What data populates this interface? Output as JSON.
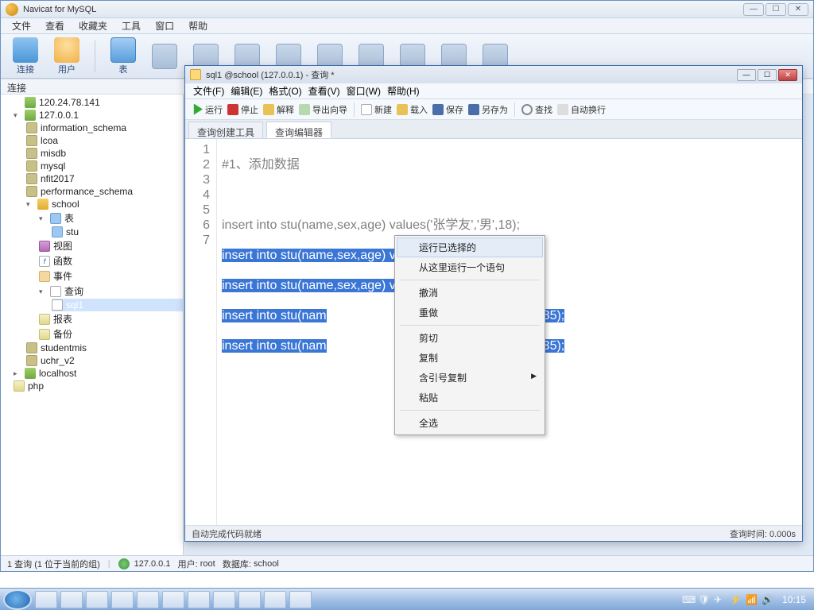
{
  "app": {
    "title": "Navicat for MySQL"
  },
  "main_menu": {
    "items": [
      "文件",
      "查看",
      "收藏夹",
      "工具",
      "窗口",
      "帮助"
    ]
  },
  "toolbar": {
    "items": [
      "连接",
      "用户",
      "表"
    ]
  },
  "conn_panel": {
    "label": "连接"
  },
  "tree": {
    "ip_server": "120.24.78.141",
    "local_server": "127.0.0.1",
    "dbs": [
      "information_schema",
      "lcoa",
      "misdb",
      "mysql",
      "nfit2017",
      "performance_schema"
    ],
    "school": "school",
    "school_nodes": {
      "table": "表",
      "stu": "stu",
      "view": "视图",
      "func": "函数",
      "event": "事件",
      "query": "查询",
      "sql1": "sql1",
      "report": "报表",
      "backup": "备份"
    },
    "dbs2": [
      "studentmis",
      "uchr_v2"
    ],
    "localhost": "localhost",
    "php": "php"
  },
  "query_window": {
    "title": "sql1 @school (127.0.0.1) - 查询 *",
    "menu": [
      "文件(F)",
      "编辑(E)",
      "格式(O)",
      "查看(V)",
      "窗口(W)",
      "帮助(H)"
    ],
    "tool": {
      "run": "运行",
      "stop": "停止",
      "explain": "解释",
      "export": "导出向导",
      "new": "新建",
      "load": "载入",
      "save": "保存",
      "saveas": "另存为",
      "find": "查找",
      "wrap": "自动换行"
    },
    "tabs": {
      "builder": "查询创建工具",
      "editor": "查询编辑器"
    },
    "lines": {
      "1": "#1、添加数据",
      "2": "",
      "3": "insert into stu(name,sex,age) values('张学友','男',18);",
      "4": "insert into stu(name,sex,age) values('张娜拉','女',73);",
      "5": "insert into stu(name,sex,age) values('张家辉','男',23);",
      "6a": "insert into stu(nam",
      "6b": "张汇美','女',85);",
      "7a": "insert into stu(nam",
      "7b": "张铁林','男',35);"
    },
    "status": {
      "left": "自动完成代码就绪",
      "right": "查询时间: 0.000s"
    }
  },
  "context_menu": {
    "run_selected": "运行已选择的",
    "run_statement": "从这里运行一个语句",
    "undo": "撤消",
    "redo": "重做",
    "cut": "剪切",
    "copy": "复制",
    "copy_quoted": "含引号复制",
    "paste": "粘贴",
    "select_all": "全选"
  },
  "status_bar": {
    "left": "1 查询 (1 位于当前的组)",
    "server": "127.0.0.1",
    "user_label": "用户:",
    "user": "root",
    "db_label": "数据库:",
    "db": "school"
  },
  "taskbar": {
    "clock": "10:15"
  }
}
